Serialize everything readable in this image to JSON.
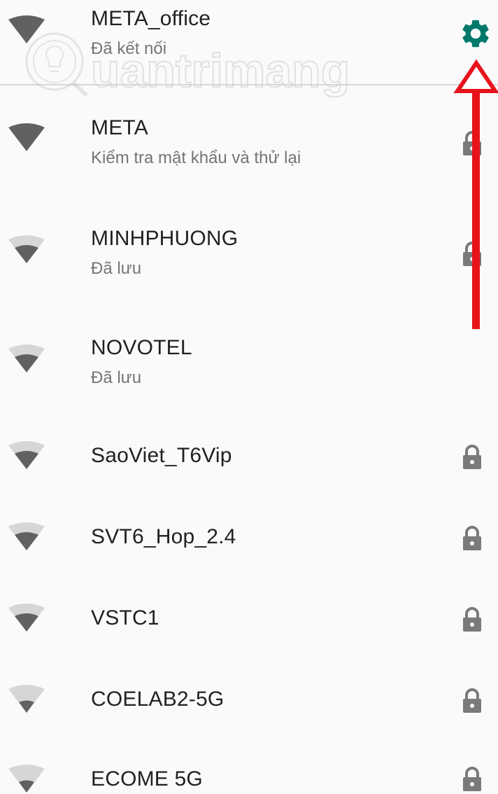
{
  "networks": [
    {
      "name": "META_office",
      "status": "Đã kết nối",
      "signal_icon": "wifi-full-signal-icon",
      "trailing_icon": "gear-icon"
    },
    {
      "name": "META",
      "status": "Kiểm tra mật khẩu và thử lại",
      "signal_icon": "wifi-full-signal-icon",
      "trailing_icon": "lock-icon"
    },
    {
      "name": "MINHPHUONG",
      "status": "Đã lưu",
      "signal_icon": "wifi-medium-signal-icon",
      "trailing_icon": "lock-icon"
    },
    {
      "name": "NOVOTEL",
      "status": "Đã lưu",
      "signal_icon": "wifi-medium-signal-icon",
      "trailing_icon": "none"
    },
    {
      "name": "SaoViet_T6Vip",
      "status": "",
      "signal_icon": "wifi-medium-signal-icon",
      "trailing_icon": "lock-icon"
    },
    {
      "name": "SVT6_Hop_2.4",
      "status": "",
      "signal_icon": "wifi-medium-signal-icon",
      "trailing_icon": "lock-icon"
    },
    {
      "name": "VSTC1",
      "status": "",
      "signal_icon": "wifi-medium-signal-icon",
      "trailing_icon": "lock-icon"
    },
    {
      "name": "COELAB2-5G",
      "status": "",
      "signal_icon": "wifi-low-signal-icon",
      "trailing_icon": "lock-icon"
    },
    {
      "name": "ECOME 5G",
      "status": "",
      "signal_icon": "wifi-low-signal-icon",
      "trailing_icon": "lock-icon"
    }
  ],
  "watermark": {
    "text": "uantrimang",
    "logo": "quantrimang-logo"
  },
  "colors": {
    "gear": "#00796b",
    "annotation_arrow": "#e8121b",
    "wifi_dark": "#616161",
    "wifi_light": "#d6d6d6",
    "lock": "#7a7a7a",
    "background": "#fafafa"
  }
}
